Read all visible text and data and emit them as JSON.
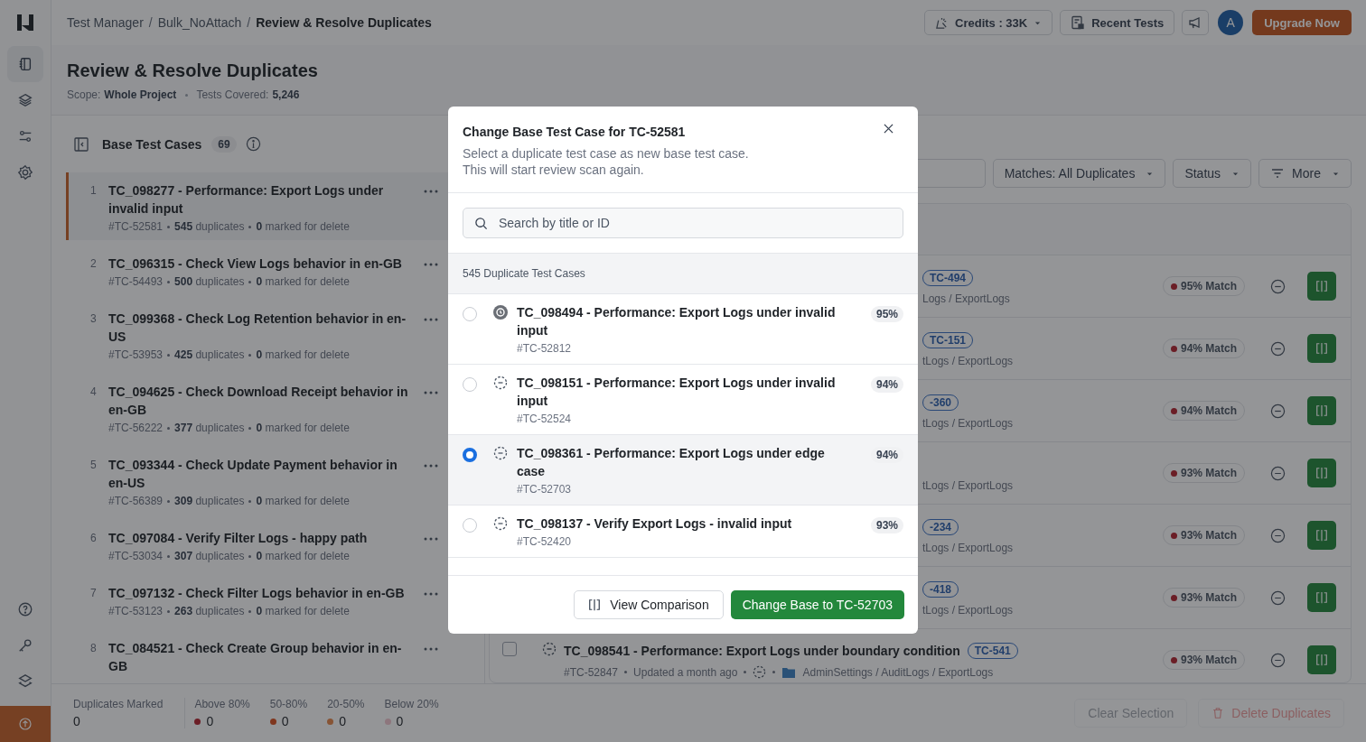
{
  "breadcrumb": {
    "items": [
      {
        "label": "Test Manager",
        "current": false
      },
      {
        "label": "Bulk_NoAttach",
        "current": false
      },
      {
        "label": "Review & Resolve Duplicates",
        "current": true
      }
    ],
    "separators": [
      "/",
      "/"
    ]
  },
  "topbar": {
    "credits": "Credits : 33K",
    "recent": "Recent Tests",
    "avatar": "A",
    "upgrade": "Upgrade Now"
  },
  "page": {
    "title": "Review & Resolve Duplicates",
    "scope_label": "Scope:",
    "scope": "Whole Project",
    "covered_label": "Tests Covered:",
    "covered": "5,246"
  },
  "base_panel": {
    "title": "Base Test Cases",
    "count": "69"
  },
  "base_cases": [
    {
      "number": "1",
      "title": "TC_098277 - Performance: Export Logs under invalid input",
      "id": "#TC-52581",
      "duplicates": "**545** duplicates",
      "marked": "**0** marked for delete",
      "selected": true
    },
    {
      "number": "2",
      "title": "TC_096315 - Check View Logs behavior in en-GB",
      "id": "#TC-54493",
      "duplicates": "**500** duplicates",
      "marked": "**0** marked for delete",
      "selected": false
    },
    {
      "number": "3",
      "title": "TC_099368 - Check Log Retention behavior in en-US",
      "id": "#TC-53953",
      "duplicates": "**425** duplicates",
      "marked": "**0** marked for delete",
      "selected": false
    },
    {
      "number": "4",
      "title": "TC_094625 - Check Download Receipt behavior in en-GB",
      "id": "#TC-56222",
      "duplicates": "**377** duplicates",
      "marked": "**0** marked for delete",
      "selected": false
    },
    {
      "number": "5",
      "title": "TC_093344 - Check Update Payment behavior in en-US",
      "id": "#TC-56389",
      "duplicates": "**309** duplicates",
      "marked": "**0** marked for delete",
      "selected": false
    },
    {
      "number": "6",
      "title": "TC_097084 - Verify Filter Logs - happy path",
      "id": "#TC-53034",
      "duplicates": "**307** duplicates",
      "marked": "**0** marked for delete",
      "selected": false
    },
    {
      "number": "7",
      "title": "TC_097132 - Check Filter Logs behavior in en-GB",
      "id": "#TC-53123",
      "duplicates": "**263** duplicates",
      "marked": "**0** marked for delete",
      "selected": false
    },
    {
      "number": "8",
      "title": "TC_084521 - Check Create Group behavior in en-GB",
      "selected": false
    }
  ],
  "filters": [
    {
      "label": "Matches: All Duplicates",
      "kind": "dropdown"
    },
    {
      "label": "Status",
      "kind": "dropdown"
    },
    {
      "label": "More",
      "kind": "menu"
    }
  ],
  "duplicates": [
    {
      "kind": "partial",
      "tag": "TC-494",
      "path": "Logs / ExportLogs",
      "match": "95% Match"
    },
    {
      "kind": "partial",
      "tag": "TC-151",
      "path": "tLogs / ExportLogs",
      "match": "94% Match"
    },
    {
      "kind": "partial",
      "tag": "-360",
      "path": "tLogs / ExportLogs",
      "match": "94% Match"
    },
    {
      "kind": "partial",
      "path": "tLogs / ExportLogs",
      "match": "93% Match"
    },
    {
      "kind": "partial",
      "tag": "-234",
      "path": "tLogs / ExportLogs",
      "match": "93% Match"
    },
    {
      "kind": "partial",
      "tag": "-418",
      "path": "tLogs / ExportLogs",
      "match": "93% Match"
    },
    {
      "kind": "full",
      "checked": false,
      "title": "TC_098541 - Performance: Export Logs under boundary condition",
      "tag": "TC-541",
      "id": "#TC-52847",
      "updated": "Updated a month ago",
      "path": "AdminSettings / AuditLogs / ExportLogs",
      "match": "93% Match"
    }
  ],
  "modal": {
    "title": "Change Base Test Case for TC-52581",
    "description": [
      "Select a duplicate test case as new base test case.",
      "This will start review scan again."
    ],
    "search_placeholder": "Search by title or ID",
    "count": "545 Duplicate Test Cases",
    "options": [
      {
        "kind": "solid",
        "title": "TC_098494 - Performance: Export Logs under invalid input",
        "id": "#TC-52812",
        "match": "95%",
        "selected": false
      },
      {
        "kind": "dashed",
        "title": "TC_098151 - Performance: Export Logs under invalid input",
        "id": "#TC-52524",
        "match": "94%",
        "selected": false
      },
      {
        "kind": "dashed",
        "title": "TC_098361 - Performance: Export Logs under edge case",
        "id": "#TC-52703",
        "match": "94%",
        "selected": true
      },
      {
        "kind": "dashed",
        "title": "TC_098137 - Verify Export Logs - invalid input",
        "id": "#TC-52420",
        "match": "93%",
        "selected": false
      }
    ],
    "secondary": "View Comparison",
    "primary": "Change Base to TC-52703"
  },
  "footer": {
    "stats": [
      {
        "label": "Duplicates Marked",
        "value": "0"
      },
      {
        "label": "Above 80%",
        "value": "0",
        "color": "#6b1e26"
      },
      {
        "label": "50-80%",
        "value": "0",
        "color": "#7f361e"
      },
      {
        "label": "20-50%",
        "value": "0",
        "color": "#875435"
      },
      {
        "label": "Below 20%",
        "value": "0",
        "color": "#8d767d"
      }
    ],
    "buttons": [
      {
        "label": "Clear Selection",
        "kind": "plain",
        "disabled": true
      },
      {
        "label": "Delete Duplicates",
        "kind": "danger",
        "disabled": true
      }
    ]
  }
}
